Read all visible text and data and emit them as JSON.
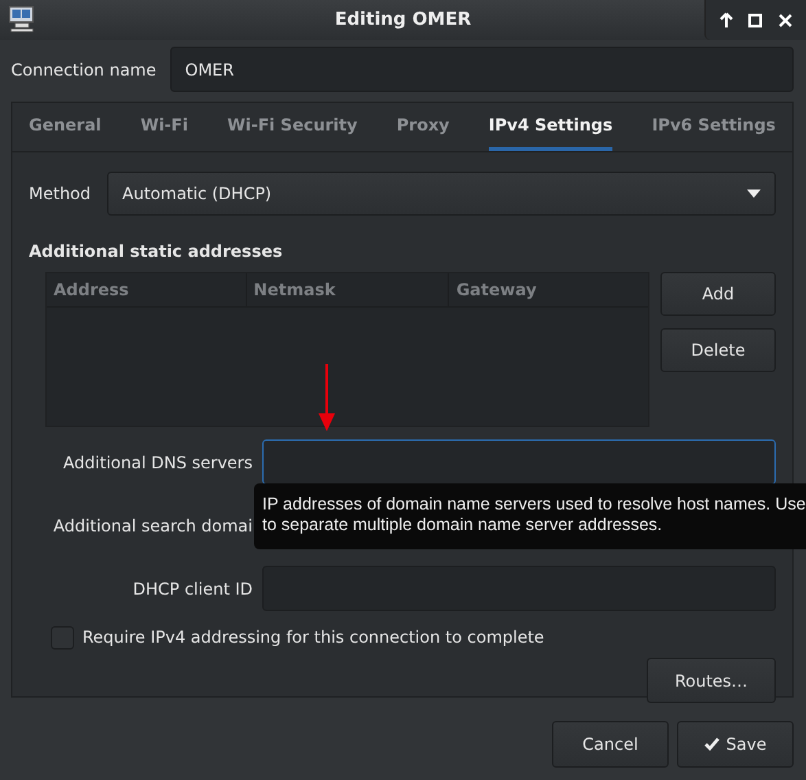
{
  "window": {
    "title": "Editing OMER"
  },
  "connection_name": {
    "label": "Connection name",
    "value": "OMER"
  },
  "tabs": [
    {
      "label": "General",
      "selected": false
    },
    {
      "label": "Wi-Fi",
      "selected": false
    },
    {
      "label": "Wi-Fi Security",
      "selected": false
    },
    {
      "label": "Proxy",
      "selected": false
    },
    {
      "label": "IPv4 Settings",
      "selected": true
    },
    {
      "label": "IPv6 Settings",
      "selected": false
    }
  ],
  "method": {
    "label": "Method",
    "value": "Automatic (DHCP)"
  },
  "static_addresses": {
    "heading": "Additional static addresses",
    "columns": [
      "Address",
      "Netmask",
      "Gateway"
    ],
    "buttons": [
      "Add",
      "Delete"
    ]
  },
  "fields": [
    {
      "label": "Additional DNS servers",
      "focused": true
    },
    {
      "label": "Additional search domai"
    },
    {
      "label": "DHCP client ID"
    }
  ],
  "require_checkbox": {
    "label": "Require IPv4 addressing for this connection to complete",
    "checked": false
  },
  "routes_button": "Routes…",
  "tooltip": {
    "lines": [
      "IP addresses of domain name servers used to resolve host names. Use",
      "to separate multiple domain name server addresses."
    ]
  },
  "footer_buttons": [
    {
      "label": "Cancel",
      "kind": "plain"
    },
    {
      "label": "Save",
      "kind": "confirm"
    }
  ]
}
